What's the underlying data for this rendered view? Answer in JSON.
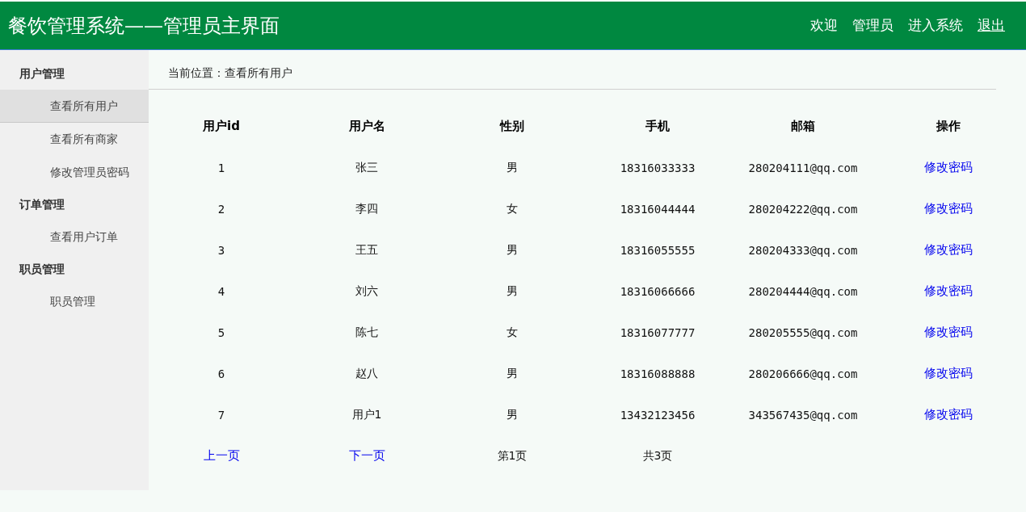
{
  "header": {
    "title": "餐饮管理系统——管理员主界面",
    "links": [
      {
        "label": "欢迎",
        "kind": "text"
      },
      {
        "label": "管理员",
        "kind": "text"
      },
      {
        "label": "进入系统",
        "kind": "text"
      },
      {
        "label": "退出",
        "kind": "link"
      }
    ]
  },
  "sidebar": {
    "groups": [
      {
        "title": "用户管理",
        "items": [
          {
            "label": "查看所有用户",
            "selected": true
          },
          {
            "label": "查看所有商家",
            "selected": false
          },
          {
            "label": "修改管理员密码",
            "selected": false
          }
        ]
      },
      {
        "title": "订单管理",
        "items": [
          {
            "label": "查看用户订单",
            "selected": false
          }
        ]
      },
      {
        "title": "职员管理",
        "items": [
          {
            "label": "职员管理",
            "selected": false
          }
        ]
      }
    ]
  },
  "breadcrumb": "当前位置：查看所有用户",
  "table": {
    "columns": [
      "用户id",
      "用户名",
      "性别",
      "手机",
      "邮箱",
      "操作"
    ],
    "rows": [
      [
        "1",
        "张三",
        "男",
        "18316033333",
        "280204111@qq.com",
        "修改密码"
      ],
      [
        "2",
        "李四",
        "女",
        "18316044444",
        "280204222@qq.com",
        "修改密码"
      ],
      [
        "3",
        "王五",
        "男",
        "18316055555",
        "280204333@qq.com",
        "修改密码"
      ],
      [
        "4",
        "刘六",
        "男",
        "18316066666",
        "280204444@qq.com",
        "修改密码"
      ],
      [
        "5",
        "陈七",
        "女",
        "18316077777",
        "280205555@qq.com",
        "修改密码"
      ],
      [
        "6",
        "赵八",
        "男",
        "18316088888",
        "280206666@qq.com",
        "修改密码"
      ],
      [
        "7",
        "用户1",
        "男",
        "13432123456",
        "343567435@qq.com",
        "修改密码"
      ]
    ]
  },
  "pagination": [
    {
      "label": "上一页",
      "kind": "link"
    },
    {
      "label": "下一页",
      "kind": "link"
    },
    {
      "label": "第1页",
      "kind": "text"
    },
    {
      "label": "共3页",
      "kind": "text"
    }
  ]
}
